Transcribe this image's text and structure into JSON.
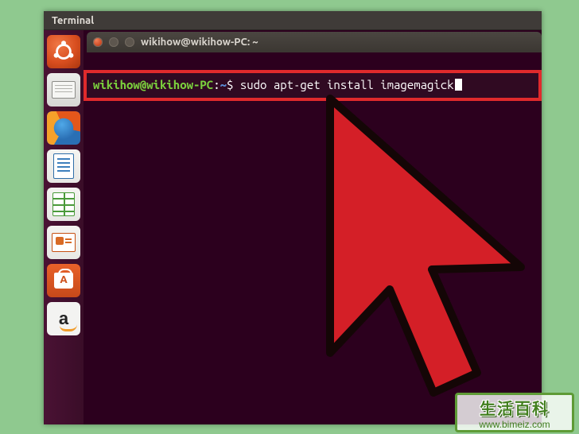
{
  "menubar": {
    "app_name": "Terminal"
  },
  "titlebar": {
    "title": "wikihow@wikihow-PC: ~"
  },
  "terminal": {
    "prompt_userhost": "wikihow@wikihow-PC",
    "prompt_sep": ":",
    "prompt_path": "~",
    "prompt_symbol": "$",
    "command": "sudo apt-get install imagemagick"
  },
  "launcher": {
    "items": [
      {
        "name": "dash-icon"
      },
      {
        "name": "files-icon"
      },
      {
        "name": "firefox-icon"
      },
      {
        "name": "libreoffice-writer-icon"
      },
      {
        "name": "libreoffice-calc-icon"
      },
      {
        "name": "libreoffice-impress-icon"
      },
      {
        "name": "ubuntu-software-icon"
      },
      {
        "name": "amazon-icon"
      }
    ]
  },
  "watermark": {
    "line1": "生活百科",
    "line2": "www.bimeiz.com"
  }
}
